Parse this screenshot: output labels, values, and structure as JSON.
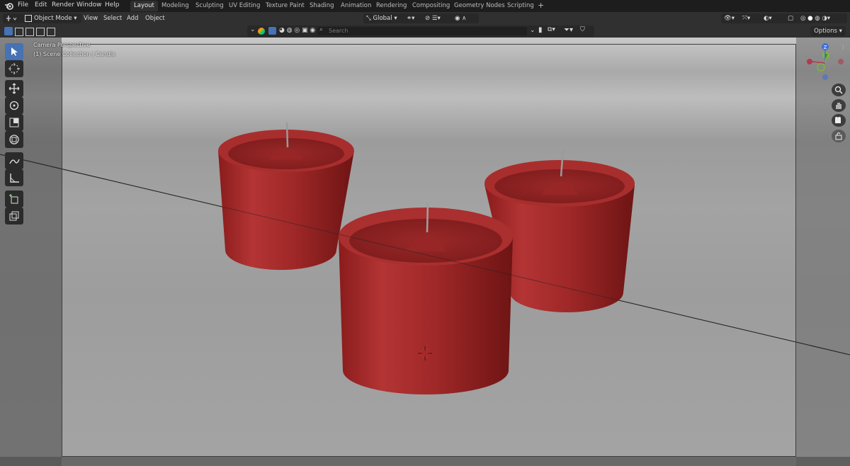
{
  "menu": {
    "items": [
      "File",
      "Edit",
      "Render",
      "Window",
      "Help"
    ]
  },
  "workspaces": {
    "tabs": [
      "Layout",
      "Modeling",
      "Sculpting",
      "UV Editing",
      "Texture Paint",
      "Shading",
      "Animation",
      "Rendering",
      "Compositing",
      "Geometry Nodes",
      "Scripting"
    ],
    "add": "+"
  },
  "header": {
    "mode": "Object Mode",
    "view": "View",
    "select": "Select",
    "add": "Add",
    "object": "Object",
    "orientation": "Global"
  },
  "row2": {
    "search_placeholder": "Search",
    "options": "Options"
  },
  "viewport": {
    "perspective_label": "Camera Perspective",
    "collection_label": "(1) Scene Collection | Candle"
  },
  "gizmo": {
    "z": "Z",
    "y": "Y"
  },
  "colors": {
    "accent": "#4772b3",
    "candle": "#a02828",
    "header_bg": "#303030"
  },
  "icons": [
    "blender-logo-icon",
    "select-box-icon",
    "cursor-icon",
    "move-icon",
    "rotate-icon",
    "scale-icon",
    "transform-icon",
    "annotate-icon",
    "measure-icon",
    "add-cube-icon",
    "zoom-icon",
    "hand-icon",
    "camera-icon",
    "lock-icon",
    "search-icon"
  ]
}
